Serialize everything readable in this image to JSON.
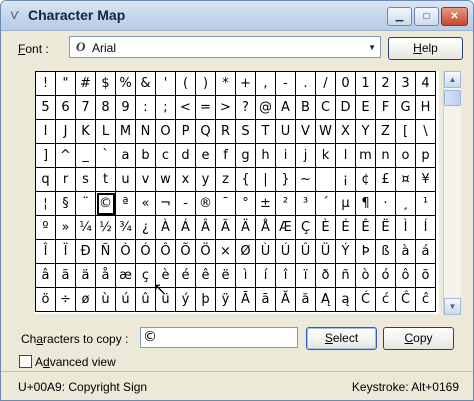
{
  "window": {
    "title": "Character Map",
    "min_glyph": "▁",
    "max_glyph": "□",
    "close_glyph": "✕",
    "app_icon_glyph": "Ѵ"
  },
  "font": {
    "label_prefix": "F",
    "label_rest": "ont :",
    "selected_font": "Arial",
    "font_type_glyph": "O",
    "dropdown_glyph": "▼"
  },
  "help_button": {
    "label_prefix": "H",
    "label_rest": "elp"
  },
  "characters": [
    [
      "!",
      "\"",
      "#",
      "$",
      "%",
      "&",
      "'",
      "(",
      ")",
      "*",
      "+",
      ",",
      "-",
      ".",
      "/",
      "0",
      "1",
      "2",
      "3",
      "4"
    ],
    [
      "5",
      "6",
      "7",
      "8",
      "9",
      ":",
      ";",
      "<",
      "=",
      ">",
      "?",
      "@",
      "A",
      "B",
      "C",
      "D",
      "E",
      "F",
      "G",
      "H"
    ],
    [
      "I",
      "J",
      "K",
      "L",
      "M",
      "N",
      "O",
      "P",
      "Q",
      "R",
      "S",
      "T",
      "U",
      "V",
      "W",
      "X",
      "Y",
      "Z",
      "[",
      "\\"
    ],
    [
      "]",
      "^",
      "_",
      "`",
      "a",
      "b",
      "c",
      "d",
      "e",
      "f",
      "g",
      "h",
      "i",
      "j",
      "k",
      "l",
      "m",
      "n",
      "o",
      "p"
    ],
    [
      "q",
      "r",
      "s",
      "t",
      "u",
      "v",
      "w",
      "x",
      "y",
      "z",
      "{",
      "|",
      "}",
      "~",
      " ",
      "¡",
      "¢",
      "£",
      "¤",
      "¥"
    ],
    [
      "¦",
      "§",
      "¨",
      "©",
      "ª",
      "«",
      "¬",
      "-",
      "®",
      "¯",
      "°",
      "±",
      "²",
      "³",
      "´",
      "µ",
      "¶",
      "·",
      "¸",
      "¹"
    ],
    [
      "º",
      "»",
      "¼",
      "½",
      "¾",
      "¿",
      "À",
      "Á",
      "Â",
      "Ã",
      "Ä",
      "Å",
      "Æ",
      "Ç",
      "È",
      "É",
      "Ê",
      "Ë",
      "Ì",
      "Í"
    ],
    [
      "Î",
      "Ï",
      "Ð",
      "Ñ",
      "Ò",
      "Ó",
      "Ô",
      "Õ",
      "Ö",
      "×",
      "Ø",
      "Ù",
      "Ú",
      "Û",
      "Ü",
      "Ý",
      "Þ",
      "ß",
      "à",
      "á"
    ],
    [
      "â",
      "ã",
      "ä",
      "å",
      "æ",
      "ç",
      "è",
      "é",
      "ê",
      "ë",
      "ì",
      "í",
      "î",
      "ï",
      "ð",
      "ñ",
      "ò",
      "ó",
      "ô",
      "õ"
    ],
    [
      "ö",
      "÷",
      "ø",
      "ù",
      "ú",
      "û",
      "ü",
      "ý",
      "þ",
      "ÿ",
      "Ā",
      "ā",
      "Ă",
      "ă",
      "Ą",
      "ą",
      "Ć",
      "ć",
      "Ĉ",
      "ĉ"
    ]
  ],
  "selected_char": "©",
  "scroll_up_glyph": "▲",
  "scroll_down_glyph": "▼",
  "cursor_glyph": "↖",
  "copy": {
    "label_pre": "Ch",
    "label_u": "a",
    "label_post": "racters to copy :",
    "value": "©"
  },
  "select_button": {
    "label_pre": "",
    "label_u": "S",
    "label_post": "elect"
  },
  "copy_button": {
    "label_pre": "",
    "label_u": "C",
    "label_post": "opy"
  },
  "advanced_view": {
    "label_pre": "A",
    "label_u": "d",
    "label_post": "vanced view",
    "checked": false
  },
  "status": {
    "code": "U+00A9: Copyright Sign",
    "keystroke": "Keystroke: Alt+0169"
  }
}
